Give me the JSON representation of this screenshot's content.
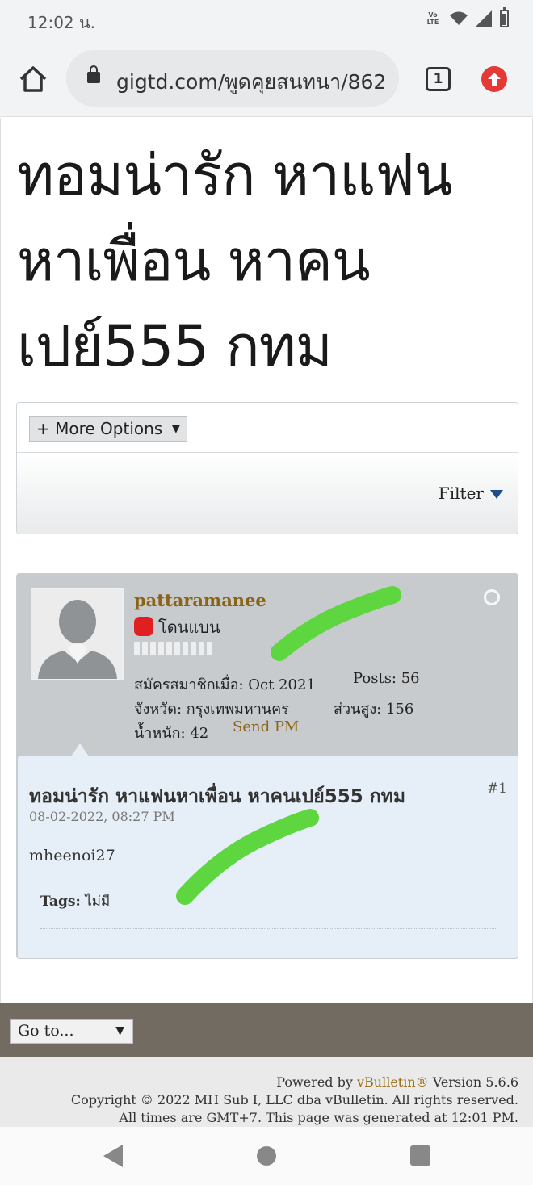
{
  "status_bar": {
    "time": "12:02 น.",
    "volte": "VoLTE"
  },
  "browser": {
    "url": "gigtd.com/พูดคุยสนทนา/862",
    "tab_count": "1"
  },
  "page": {
    "title": "ทอมน่ารัก หาแฟนหาเพื่อน หาคนเปย์555 กทม",
    "more_options_label": "+ More Options",
    "filter_label": "Filter"
  },
  "post": {
    "username": "pattaramanee",
    "status": "โดนแบน",
    "joined_label": "สมัครสมาชิกเมื่อ:",
    "joined_value": "Oct 2021",
    "posts_label": "Posts:",
    "posts_value": "56",
    "province_label": "จังหวัด:",
    "province_value": "กรุงเทพมหานคร",
    "height_label": "ส่วนสูง:",
    "height_value": "156",
    "weight_label": "น้ำหนัก:",
    "weight_value": "42",
    "send_pm": "Send PM",
    "title": "ทอมน่ารัก หาแฟนหาเพื่อน หาคนเปย์555 กทม",
    "number": "#1",
    "date": "08-02-2022, 08:27 PM",
    "content": "mheenoi27",
    "tags_label": "Tags:",
    "tags_value": "ไม่มี"
  },
  "footer": {
    "goto_label": "Go to...",
    "powered_by": "Powered by",
    "vbulletin": "vBulletin®",
    "version": "Version 5.6.6",
    "copyright": "Copyright © 2022 MH Sub I, LLC dba vBulletin. All rights reserved.",
    "times": "All times are GMT+7. This page was generated at 12:01 PM."
  },
  "colors": {
    "username": "#8a6414",
    "banned_dot": "#e02020",
    "scribble": "#5ed63f",
    "footer_bar": "#716b62"
  }
}
